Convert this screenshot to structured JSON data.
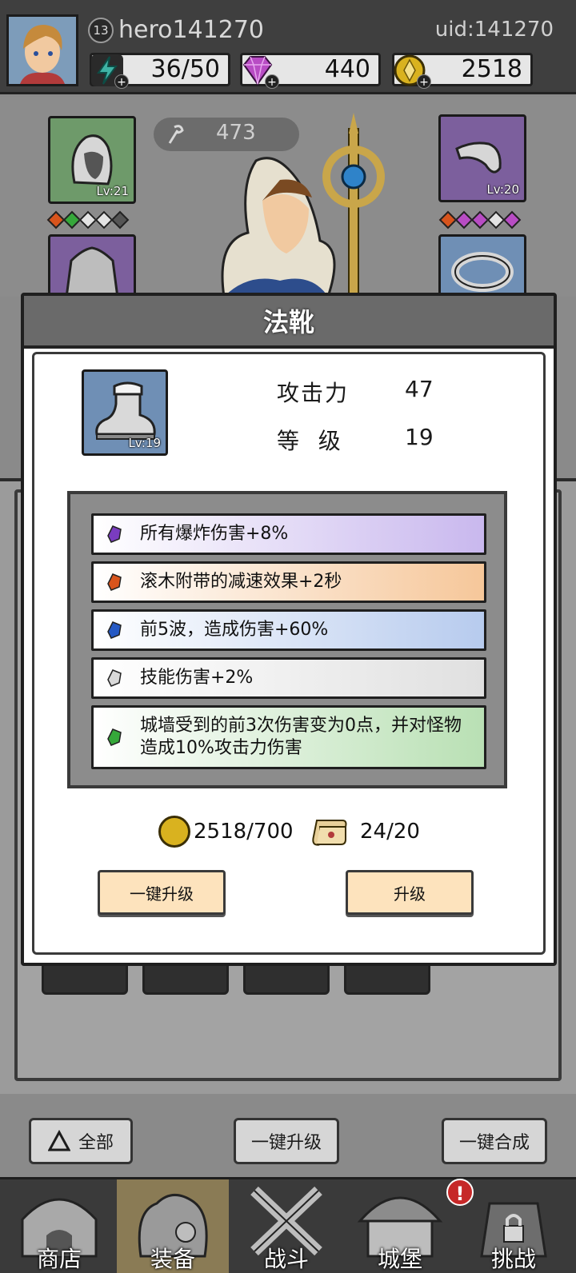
{
  "player": {
    "level": "13",
    "name": "hero141270",
    "uid_label": "uid:",
    "uid_value": "141270"
  },
  "resources": {
    "energy": "36/50",
    "gems": "440",
    "gold": "2518"
  },
  "background": {
    "power": "473",
    "left_top_slot_level": "Lv:21",
    "right_top_slot_level": "Lv:20"
  },
  "modal": {
    "title": "法靴",
    "item_level": "Lv:19",
    "stats": [
      {
        "label": "攻击力",
        "value": "47"
      },
      {
        "label": "等  级",
        "value": "19"
      }
    ],
    "affixes": [
      {
        "text": "所有爆炸伤害+8%",
        "color": "#b9a8e0",
        "gem_color": "#7a3cc0"
      },
      {
        "text": "滚木附带的减速效果+2秒",
        "color": "#f6c79a",
        "gem_color": "#d8541c"
      },
      {
        "text": "前5波，造成伤害+60%",
        "color": "#b7cbee",
        "gem_color": "#2559c4"
      },
      {
        "text": "技能伤害+2%",
        "color": "#e3e3e3",
        "gem_color": "#bdbdbd"
      },
      {
        "text": "城墙受到的前3次伤害变为0点，并对怪物造成10%攻击力伤害",
        "color": "#b9e0b4",
        "gem_color": "#35a83a"
      }
    ],
    "gold_cost": "2518/700",
    "scroll_cost": "24/20",
    "btn_one_key_upgrade": "一键升级",
    "btn_upgrade": "升级"
  },
  "bottom_bar": {
    "all": "全部",
    "one_key_upgrade": "一键升级",
    "one_key_merge": "一键合成"
  },
  "nav": {
    "tabs": [
      "商店",
      "装备",
      "战斗",
      "城堡",
      "挑战"
    ],
    "active": 1,
    "castle_alert": "!"
  },
  "colors": {
    "topbar": "#3f3f3f",
    "affix_border": "#1f1f1f",
    "button_fill": "#fde3bd",
    "active_tab": "#8a7b55"
  }
}
